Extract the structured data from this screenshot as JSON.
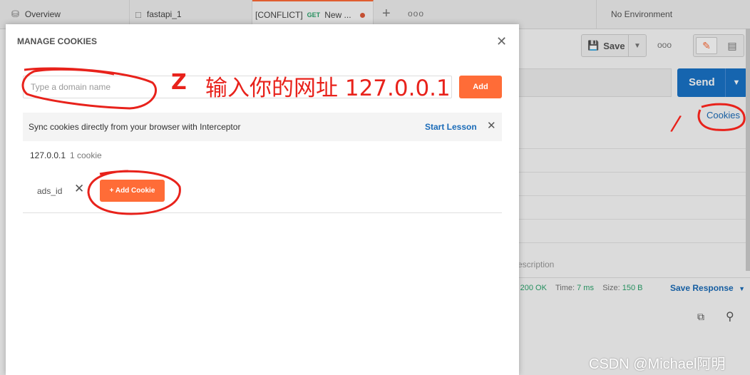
{
  "tabs": [
    {
      "label": "Overview",
      "icon": "overview-icon"
    },
    {
      "label": "fastapi_1",
      "icon": "file-icon"
    },
    {
      "prefix": "[CONFLICT]",
      "method": "GET",
      "label": "New ..."
    }
  ],
  "tabbar": {
    "plus": "+",
    "more": "ooo"
  },
  "environment": {
    "label": "No Environment"
  },
  "toolbar": {
    "save_label": "Save",
    "more": "ooo"
  },
  "request": {
    "send_label": "Send",
    "cookies_link": "Cookies",
    "description_placeholder": "escription"
  },
  "response": {
    "status_label": "s:",
    "status_value": "200 OK",
    "time_label": "Time:",
    "time_value": "7 ms",
    "size_label": "Size:",
    "size_value": "150 B",
    "save_response_label": "Save Response"
  },
  "modal": {
    "title": "MANAGE COOKIES",
    "domain_placeholder": "Type a domain name",
    "add_label": "Add",
    "banner_text": "Sync cookies directly from your browser with Interceptor",
    "start_lesson_label": "Start Lesson",
    "host": "127.0.0.1",
    "host_count": "1 cookie",
    "cookie_name": "ads_id",
    "add_cookie_label": "+ Add Cookie"
  },
  "annotations": {
    "step2_marker": "Z",
    "step2_text": "输入你的网址 127.0.0.1",
    "step1_marker": "/"
  },
  "watermark": "CSDN @Michael阿明",
  "colors": {
    "accent": "#ff6c37",
    "send": "#1a73c8",
    "link": "#1a6bb8",
    "annotation": "#e8221b"
  }
}
